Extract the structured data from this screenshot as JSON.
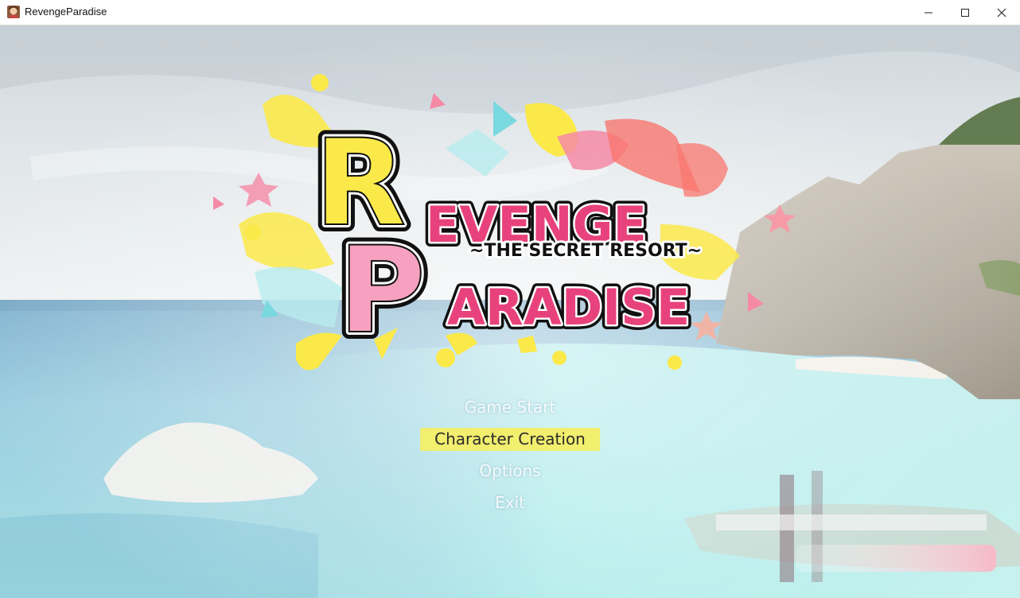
{
  "window": {
    "title": "RevengeParadise",
    "icon": "app-icon"
  },
  "window_controls": {
    "minimize": "minimize-icon",
    "maximize": "maximize-icon",
    "close": "close-icon"
  },
  "logo": {
    "big_letter_1": "R",
    "word_1": "EVENGE",
    "subtitle": "~THE SECRET RESORT~",
    "big_letter_2": "P",
    "word_2": "ARADISE"
  },
  "menu": {
    "items": [
      {
        "label": "Game Start",
        "selected": false
      },
      {
        "label": "Character Creation",
        "selected": true
      },
      {
        "label": "Options",
        "selected": false
      },
      {
        "label": "Exit",
        "selected": false
      }
    ]
  },
  "colors": {
    "highlight": "#f2ee6e",
    "logo_pink": "#e8427c",
    "logo_yellow": "#fbe94a"
  }
}
